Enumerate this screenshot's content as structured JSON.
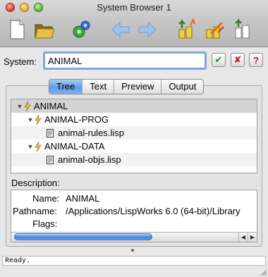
{
  "window": {
    "title": "System Browser 1"
  },
  "toolbar": {
    "buttons": [
      {
        "icon": "new-document-icon"
      },
      {
        "icon": "open-folder-icon"
      },
      {
        "icon": "gear-settings-icon"
      },
      {
        "icon": "back-arrow-icon"
      },
      {
        "icon": "forward-arrow-icon"
      },
      {
        "icon": "compile-icon"
      },
      {
        "icon": "load-icon"
      },
      {
        "icon": "build-icon"
      }
    ]
  },
  "system": {
    "label": "System:",
    "value": "ANIMAL",
    "ok_symbol": "✔",
    "cancel_symbol": "✘",
    "help_symbol": "?"
  },
  "tabs": [
    "Tree",
    "Text",
    "Preview",
    "Output"
  ],
  "active_tab": "Tree",
  "tree": [
    {
      "label": "ANIMAL",
      "kind": "system",
      "level": 0
    },
    {
      "label": "ANIMAL-PROG",
      "kind": "system",
      "level": 1
    },
    {
      "label": "animal-rules.lisp",
      "kind": "file",
      "level": 2
    },
    {
      "label": "ANIMAL-DATA",
      "kind": "system",
      "level": 1
    },
    {
      "label": "animal-objs.lisp",
      "kind": "file",
      "level": 2
    }
  ],
  "description": {
    "label": "Description:",
    "name_key": "Name:",
    "name_value": "ANIMAL",
    "path_key": "Pathname:",
    "path_value": "/Applications/LispWorks 6.0 (64-bit)/Library",
    "flags_key": "Flags:",
    "flags_value": ""
  },
  "status": {
    "text": "Ready."
  },
  "colors": {
    "selection_blue": "#5f9ee8",
    "focus_ring": "#7ea8dc"
  }
}
